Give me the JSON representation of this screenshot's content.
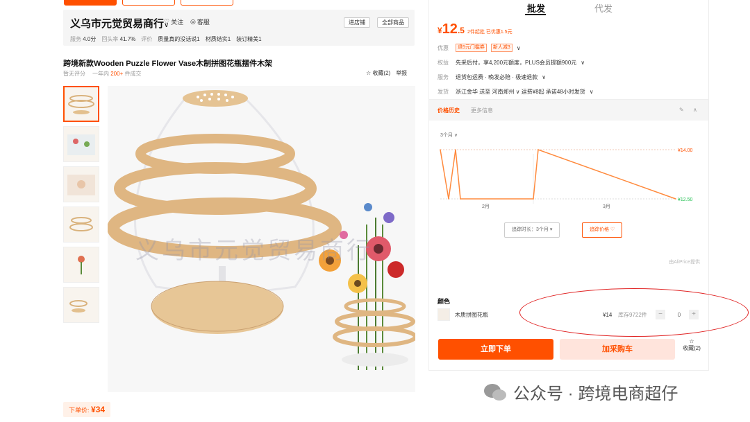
{
  "shop": {
    "name": "义乌市元觉贸易商行",
    "follow": "关注",
    "service": "客服",
    "enter_label": "进店铺",
    "all_products_label": "全部商品",
    "stats": [
      {
        "label": "服务",
        "value": "4.0分"
      },
      {
        "label": "回头率",
        "value": "41.7%"
      },
      {
        "label": "评价",
        "value": ""
      }
    ],
    "tags": [
      "质量真的没话说1",
      "材质结实1",
      "装订精美1"
    ]
  },
  "product": {
    "title": "跨境新款Wooden Puzzle Flower Vase木制拼图花瓶摆件木架",
    "no_rating": "暂无评分",
    "year": "一年内",
    "sold": "200+",
    "sold_suffix": "件成交",
    "fav_label": "收藏(2)",
    "report_label": "举报",
    "watermark": "义乌市元觉贸易商行",
    "order_price_label": "下单价:",
    "order_price": "¥34"
  },
  "panel": {
    "tabs": [
      "批发",
      "代发"
    ],
    "price_symbol": "¥",
    "price_int": "12",
    "price_dec": ".5",
    "price_note": "2件起批 已优惠1.5元",
    "coupon_label": "优惠",
    "coupons": [
      "退5元门槛券",
      "新人减3"
    ],
    "benefit_label": "权益",
    "benefit_text": "先采后付，享4,200元额度，PLUS会员提额900元",
    "service_label": "服务",
    "service_text": "退货包运费 · 晚发必赔 · 极速退款",
    "ship_label": "发货",
    "ship_text": "浙江金华 送至 河南郑州 ∨ 运费¥8起 承诺48小时发货"
  },
  "history": {
    "tabs": [
      "价格历史",
      "更多信息"
    ],
    "period": "3个月",
    "duration_btn": "追踪时长：3个月",
    "track_btn": "追踪价格",
    "source": "由AliPrice提供"
  },
  "sku": {
    "color_label": "颜色",
    "name": "木质拼图花瓶",
    "price": "¥14",
    "stock": "库存9722件",
    "qty": "0",
    "minus": "−",
    "plus": "+"
  },
  "actions": {
    "buy": "立即下单",
    "cart": "加采购车",
    "fav": "收藏(2)"
  },
  "footer": {
    "text": "公众号 · 跨境电商超仔"
  },
  "colors": {
    "accent": "#ff5000",
    "chart_line": "#ff8a3d",
    "low_price": "#1cbf4d",
    "annotation_red": "#e02020"
  },
  "chart_data": {
    "type": "line",
    "title": "",
    "x_labels": [
      "2月",
      "3月"
    ],
    "y_labels": [
      "¥14.00",
      "¥12.50"
    ],
    "x": [
      "start",
      "",
      "",
      "",
      "",
      "",
      "end"
    ],
    "values": [
      14.0,
      12.5,
      14.0,
      12.5,
      12.5,
      14.0,
      12.5
    ],
    "xlabel": "",
    "ylabel": "",
    "ylim": [
      12.5,
      14.0
    ]
  }
}
